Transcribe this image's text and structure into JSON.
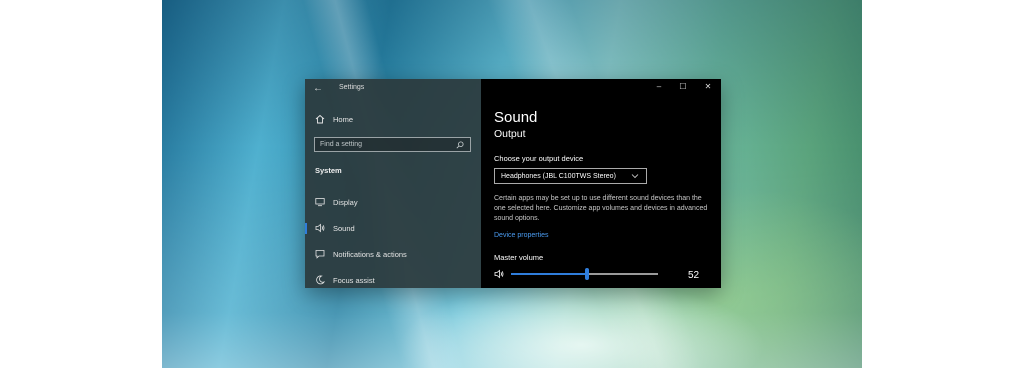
{
  "window": {
    "title": "Settings",
    "back_icon": "arrow-left-icon",
    "controls": {
      "minimize": "minimize-icon",
      "maximize": "maximize-icon",
      "close": "close-icon"
    }
  },
  "sidebar": {
    "home_label": "Home",
    "search_placeholder": "Find a setting",
    "section_title": "System",
    "items": [
      {
        "label": "Display",
        "icon": "monitor-icon",
        "active": false
      },
      {
        "label": "Sound",
        "icon": "speaker-icon",
        "active": true
      },
      {
        "label": "Notifications & actions",
        "icon": "notification-icon",
        "active": false
      },
      {
        "label": "Focus assist",
        "icon": "moon-icon",
        "active": false
      }
    ]
  },
  "content": {
    "heading": "Sound",
    "subheading": "Output",
    "output_label": "Choose your output device",
    "output_device": "Headphones (JBL C100TWS Stereo)",
    "description": "Certain apps may be set up to use different sound devices than the one selected here. Customize app volumes and devices in advanced sound options.",
    "device_properties_link": "Device properties",
    "volume_label": "Master volume",
    "volume_value": "52",
    "volume_fraction": 0.52
  },
  "colors": {
    "accent": "#2f7ddb",
    "link": "#4a9bf0",
    "sidebar_bg": "#2c3a3e",
    "content_bg": "#000000"
  }
}
